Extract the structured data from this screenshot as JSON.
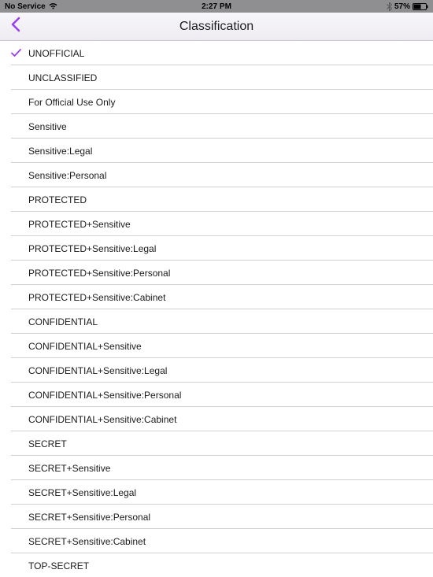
{
  "status": {
    "carrier": "No Service",
    "time": "2:27 PM",
    "battery": "57%"
  },
  "nav": {
    "title": "Classification"
  },
  "items": [
    {
      "label": "UNOFFICIAL",
      "selected": true
    },
    {
      "label": "UNCLASSIFIED",
      "selected": false
    },
    {
      "label": "For Official Use Only",
      "selected": false
    },
    {
      "label": "Sensitive",
      "selected": false
    },
    {
      "label": "Sensitive:Legal",
      "selected": false
    },
    {
      "label": "Sensitive:Personal",
      "selected": false
    },
    {
      "label": "PROTECTED",
      "selected": false
    },
    {
      "label": "PROTECTED+Sensitive",
      "selected": false
    },
    {
      "label": "PROTECTED+Sensitive:Legal",
      "selected": false
    },
    {
      "label": "PROTECTED+Sensitive:Personal",
      "selected": false
    },
    {
      "label": "PROTECTED+Sensitive:Cabinet",
      "selected": false
    },
    {
      "label": "CONFIDENTIAL",
      "selected": false
    },
    {
      "label": "CONFIDENTIAL+Sensitive",
      "selected": false
    },
    {
      "label": "CONFIDENTIAL+Sensitive:Legal",
      "selected": false
    },
    {
      "label": "CONFIDENTIAL+Sensitive:Personal",
      "selected": false
    },
    {
      "label": "CONFIDENTIAL+Sensitive:Cabinet",
      "selected": false
    },
    {
      "label": "SECRET",
      "selected": false
    },
    {
      "label": "SECRET+Sensitive",
      "selected": false
    },
    {
      "label": "SECRET+Sensitive:Legal",
      "selected": false
    },
    {
      "label": "SECRET+Sensitive:Personal",
      "selected": false
    },
    {
      "label": "SECRET+Sensitive:Cabinet",
      "selected": false
    },
    {
      "label": "TOP-SECRET",
      "selected": false
    }
  ],
  "colors": {
    "accent": "#9a3fed"
  }
}
